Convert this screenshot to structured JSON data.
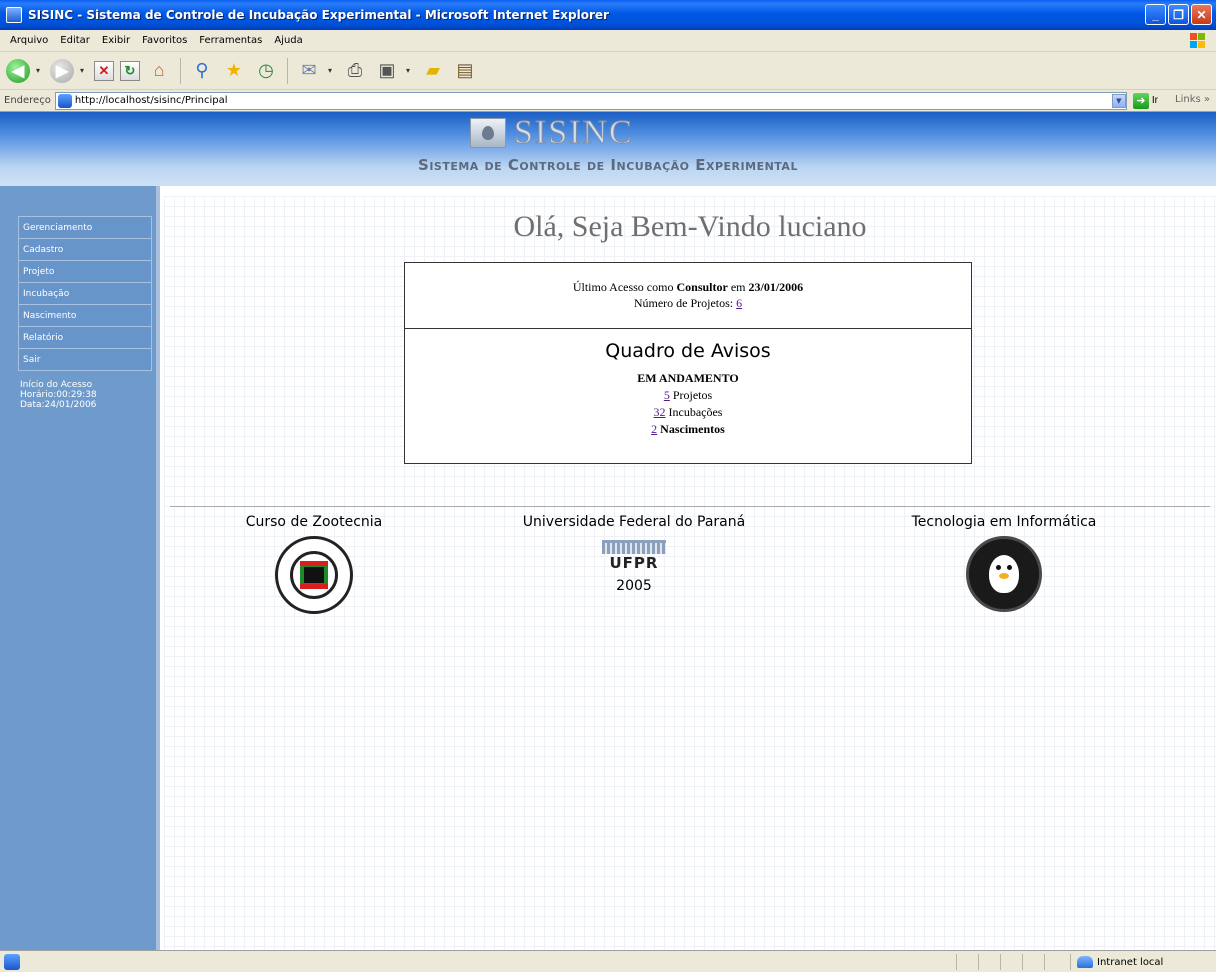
{
  "window": {
    "title": "SISINC - Sistema de Controle de Incubação Experimental - Microsoft Internet Explorer"
  },
  "menu": [
    "Arquivo",
    "Editar",
    "Exibir",
    "Favoritos",
    "Ferramentas",
    "Ajuda"
  ],
  "address": {
    "label": "Endereço",
    "url": "http://localhost/sisinc/Principal",
    "go_label": "Ir",
    "links_label": "Links"
  },
  "header": {
    "logo_text": "SISINC",
    "subtitle": "Sistema de Controle de Incubação Experimental"
  },
  "sidebar": {
    "items": [
      "Gerenciamento",
      "Cadastro",
      "Projeto",
      "Incubação",
      "Nascimento",
      "Relatório",
      "Sair"
    ],
    "access": {
      "title": "Início do Acesso",
      "time": "Horário:00:29:38",
      "date": "Data:24/01/2006"
    }
  },
  "main": {
    "welcome": "Olá, Seja Bem-Vindo luciano",
    "last_access": {
      "prefix": "Último Acesso como",
      "role": "Consultor",
      "mid": "em",
      "date": "23/01/2006"
    },
    "projects": {
      "label": "Número de Projetos:",
      "count": "6"
    },
    "notice": {
      "title": "Quadro de Avisos",
      "status": "EM ANDAMENTO",
      "items": [
        {
          "count": "5",
          "label": "Projetos"
        },
        {
          "count": "32",
          "label": "Incubações"
        },
        {
          "count": "2",
          "label": "Nascimentos"
        }
      ]
    }
  },
  "footer": {
    "left": "Curso de Zootecnia",
    "center": "Universidade Federal do Paraná",
    "center_mark": "UFPR",
    "center_year": "2005",
    "right": "Tecnologia em Informática"
  },
  "status": {
    "zone": "Intranet local"
  }
}
